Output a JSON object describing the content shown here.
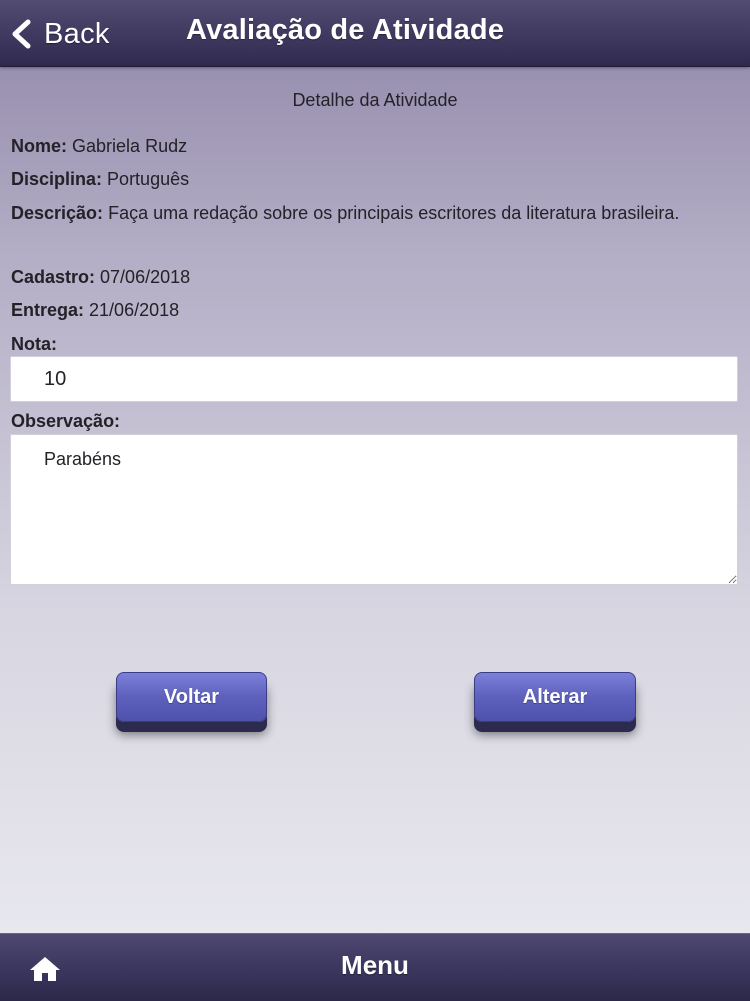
{
  "header": {
    "back_label": "Back",
    "title": "Avaliação de Atividade"
  },
  "section_title": "Detalhe da Atividade",
  "details": {
    "nome_label": "Nome:",
    "nome_value": "Gabriela Rudz",
    "disciplina_label": "Disciplina:",
    "disciplina_value": "Português",
    "descricao_label": "Descrição:",
    "descricao_value": "Faça uma redação sobre os principais escritores da literatura brasileira.",
    "cadastro_label": "Cadastro:",
    "cadastro_value": "07/06/2018",
    "entrega_label": "Entrega:",
    "entrega_value": "21/06/2018"
  },
  "form": {
    "nota_label": "Nota:",
    "nota_value": "10",
    "observacao_label": "Observação:",
    "observacao_value": "Parabéns"
  },
  "buttons": {
    "voltar": "Voltar",
    "alterar": "Alterar"
  },
  "footer": {
    "menu_label": "Menu",
    "home_icon": "home-icon"
  },
  "colors": {
    "header_bg": "#3f3960",
    "button_bg": "#5d61bd",
    "footer_bg": "#3c3760"
  }
}
